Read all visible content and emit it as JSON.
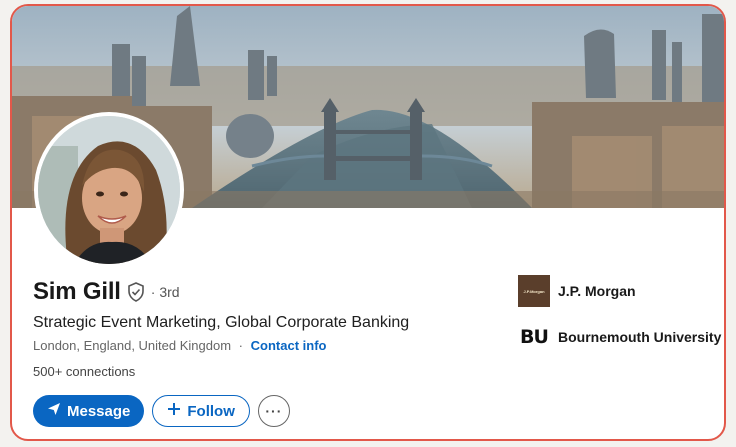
{
  "profile": {
    "name": "Sim Gill",
    "degree": "· 3rd",
    "headline": "Strategic Event Marketing, Global Corporate Banking",
    "location": "London, England, United Kingdom",
    "location_separator": "·",
    "contact_info": "Contact info",
    "connections": "500+ connections"
  },
  "actions": {
    "message_label": "Message",
    "follow_label": "Follow",
    "more_label": "···"
  },
  "organizations": [
    {
      "name": "J.P. Morgan",
      "logo_text": "J.P.Morgan",
      "icon": "jp-morgan-logo"
    },
    {
      "name": "Bournemouth University",
      "logo_text": "BU",
      "icon": "bournemouth-university-logo"
    }
  ],
  "colors": {
    "accent": "#0a66c2",
    "frame_border": "#e2584a"
  }
}
